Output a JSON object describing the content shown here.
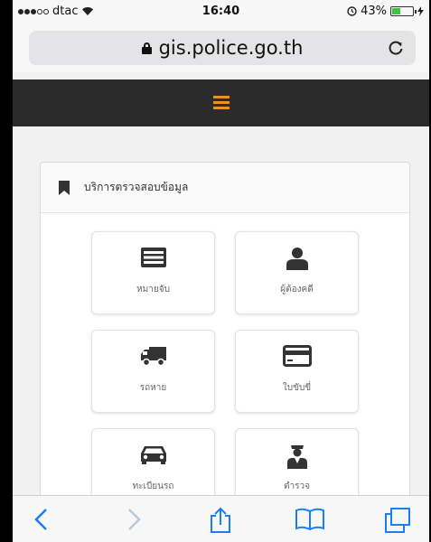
{
  "status_bar": {
    "carrier": "dtac",
    "time": "16:40",
    "battery_text": "43%",
    "battery_level": 0.43,
    "battery_color": "#3cc43c"
  },
  "browser": {
    "url": "gis.police.go.th"
  },
  "navbar": {
    "background": "#2b2b2b",
    "menu_icon_color": "#e8941a"
  },
  "panel": {
    "title": "บริการตรวจสอบข้อมูล",
    "tiles": [
      {
        "label": "หมายจับ",
        "icon": "id-card-icon"
      },
      {
        "label": "ผู้ต้องคดี",
        "icon": "user-icon"
      },
      {
        "label": "รถหาย",
        "icon": "truck-icon"
      },
      {
        "label": "ใบขับขี่",
        "icon": "credit-card-icon"
      },
      {
        "label": "ทะเบียนรถ",
        "icon": "car-icon"
      },
      {
        "label": "ตำรวจ",
        "icon": "police-icon"
      }
    ]
  },
  "toolbar": {
    "accent": "#1a7ef5",
    "buttons": [
      "back-icon",
      "forward-icon",
      "share-icon",
      "bookmarks-icon",
      "tabs-icon"
    ]
  }
}
